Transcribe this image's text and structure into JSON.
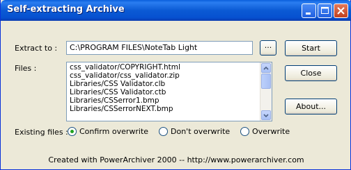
{
  "window": {
    "title": "Self-extracting Archive"
  },
  "extract": {
    "label": "Extract to :",
    "path": "C:\\PROGRAM FILES\\NoteTab Light",
    "browse_label": "..."
  },
  "files": {
    "label": "Files :",
    "items": [
      "css_validator/COPYRIGHT.html",
      "css_validator/css_validator.zip",
      "Libraries/CSS Validator.clb",
      "Libraries/CSS Validator.ctb",
      "Libraries/CSSerror1.bmp",
      "Libraries/CSSerrorNEXT.bmp"
    ]
  },
  "buttons": {
    "start": "Start",
    "close": "Close",
    "about": "About..."
  },
  "existing": {
    "label": "Existing files :",
    "options": [
      "Confirm overwrite",
      "Don't overwrite",
      "Overwrite"
    ],
    "selected": "Confirm overwrite"
  },
  "footer": {
    "text": "Created with PowerArchiver 2000 -- http://www.powerarchiver.com"
  }
}
